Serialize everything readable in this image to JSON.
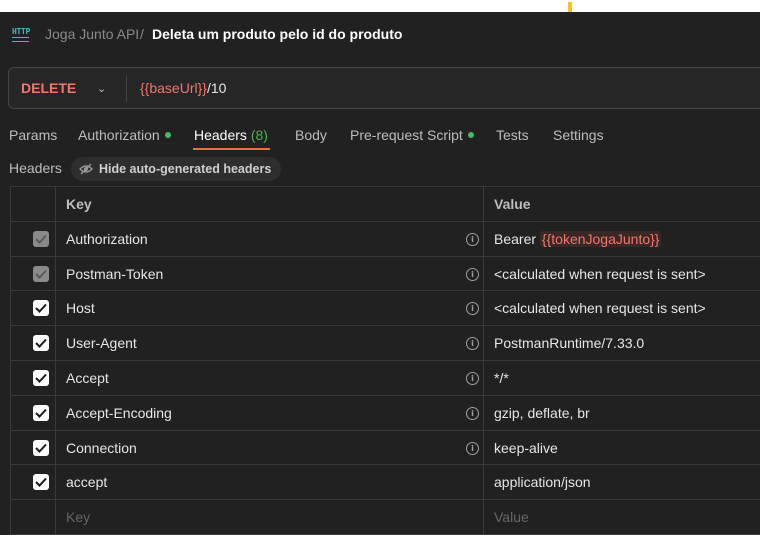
{
  "breadcrumb": {
    "collection": "Joga Junto API",
    "separator": "/",
    "request": "Deleta um produto pelo id do produto"
  },
  "request": {
    "method": "DELETE",
    "url_variable": "{{baseUrl}}",
    "url_path": "/10"
  },
  "tabs": [
    {
      "label": "Params"
    },
    {
      "label": "Authorization",
      "dot": true
    },
    {
      "label": "Headers",
      "count": "(8)",
      "active": true
    },
    {
      "label": "Body"
    },
    {
      "label": "Pre-request Script",
      "dot": true
    },
    {
      "label": "Tests"
    },
    {
      "label": "Settings"
    }
  ],
  "headers_section": {
    "title": "Headers",
    "hide_button": "Hide auto-generated headers"
  },
  "table": {
    "col_key": "Key",
    "col_value": "Value",
    "rows": [
      {
        "key": "Authorization",
        "value_prefix": "Bearer ",
        "value_var": "{{tokenJogaJunto}}",
        "checked": "dim",
        "info": true
      },
      {
        "key": "Postman-Token",
        "value": "<calculated when request is sent>",
        "checked": "dim",
        "info": true
      },
      {
        "key": "Host",
        "value": "<calculated when request is sent>",
        "checked": "on",
        "info": true
      },
      {
        "key": "User-Agent",
        "value": "PostmanRuntime/7.33.0",
        "checked": "on",
        "info": true
      },
      {
        "key": "Accept",
        "value": "*/*",
        "checked": "on",
        "info": true
      },
      {
        "key": "Accept-Encoding",
        "value": "gzip, deflate, br",
        "checked": "on",
        "info": true
      },
      {
        "key": "Connection",
        "value": "keep-alive",
        "checked": "on",
        "info": true
      },
      {
        "key": "accept",
        "value": "application/json",
        "checked": "on",
        "info": false
      }
    ],
    "placeholder_key": "Key",
    "placeholder_value": "Value"
  },
  "colors": {
    "accent_orange": "#f26b3a",
    "method_red": "#f0776c",
    "status_green": "#3fbf5f"
  }
}
